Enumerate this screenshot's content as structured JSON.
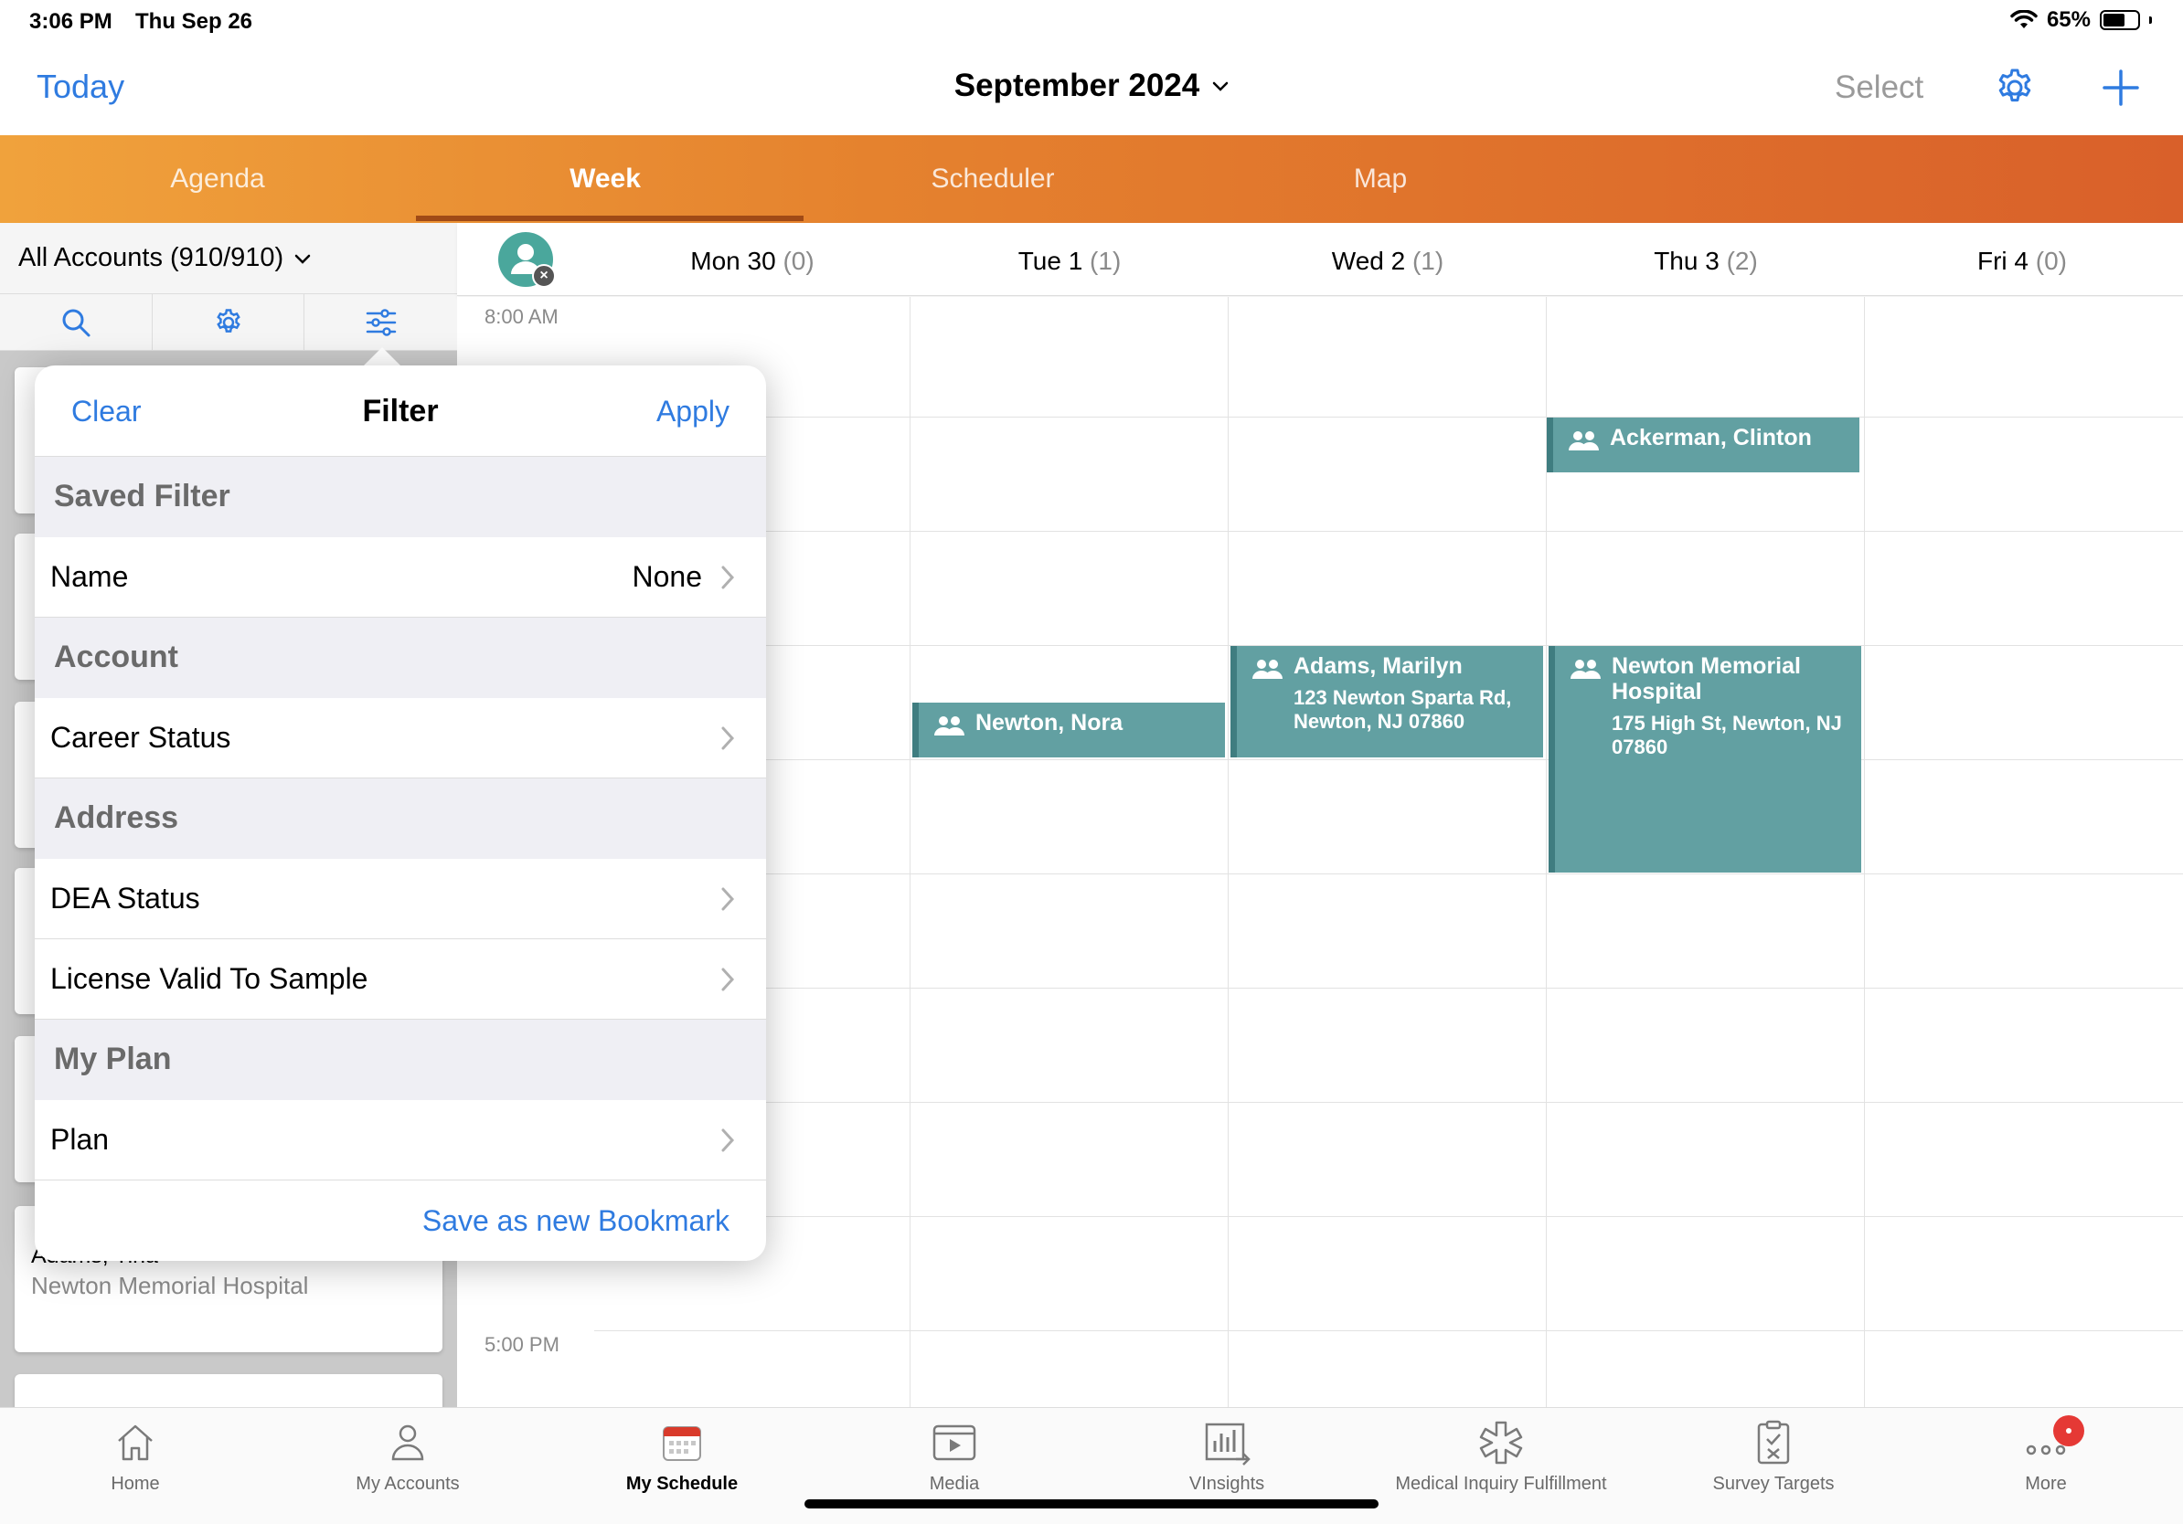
{
  "status": {
    "time": "3:06 PM",
    "date": "Thu Sep 26",
    "battery": "65%",
    "battery_level": 0.65
  },
  "nav": {
    "today": "Today",
    "title": "September 2024",
    "select": "Select"
  },
  "tabs": [
    {
      "label": "Agenda"
    },
    {
      "label": "Week"
    },
    {
      "label": "Scheduler"
    },
    {
      "label": "Map"
    }
  ],
  "active_tab": "Week",
  "accounts": {
    "title": "All Accounts (910/910)"
  },
  "left_list": [
    {
      "name": "Adams, Tina",
      "subtitle": "Newton Memorial Hospital"
    }
  ],
  "days": [
    {
      "label": "Mon 30",
      "count": "(0)"
    },
    {
      "label": "Tue 1",
      "count": "(1)"
    },
    {
      "label": "Wed 2",
      "count": "(1)"
    },
    {
      "label": "Thu 3",
      "count": "(2)"
    },
    {
      "label": "Fri 4",
      "count": "(0)"
    }
  ],
  "times": {
    "start": "8:00 AM",
    "end": "5:00 PM"
  },
  "events": [
    {
      "title": "Ackerman, Clinton",
      "address": ""
    },
    {
      "title": "Newton, Nora",
      "address": ""
    },
    {
      "title": "Adams, Marilyn",
      "address": "123 Newton Sparta Rd, Newton, NJ 07860"
    },
    {
      "title": "Newton Memorial Hospital",
      "address": "175 High St, Newton, NJ 07860"
    }
  ],
  "filter": {
    "clear": "Clear",
    "title": "Filter",
    "apply": "Apply",
    "sections": [
      {
        "header": "Saved Filter",
        "rows": [
          {
            "label": "Name",
            "value": "None"
          }
        ]
      },
      {
        "header": "Account",
        "rows": [
          {
            "label": "Career Status",
            "value": ""
          }
        ]
      },
      {
        "header": "Address",
        "rows": [
          {
            "label": "DEA Status",
            "value": ""
          },
          {
            "label": "License Valid To Sample",
            "value": ""
          }
        ]
      },
      {
        "header": "My Plan",
        "rows": [
          {
            "label": "Plan",
            "value": ""
          }
        ]
      }
    ],
    "bookmark": "Save as new Bookmark"
  },
  "bottom_tabs": [
    {
      "label": "Home",
      "icon": "home-icon"
    },
    {
      "label": "My Accounts",
      "icon": "person-icon"
    },
    {
      "label": "My Schedule",
      "icon": "calendar-icon"
    },
    {
      "label": "Media",
      "icon": "media-icon"
    },
    {
      "label": "VInsights",
      "icon": "chart-icon"
    },
    {
      "label": "Medical Inquiry Fulfillment",
      "icon": "medical-icon"
    },
    {
      "label": "Survey Targets",
      "icon": "clipboard-icon"
    },
    {
      "label": "More",
      "icon": "more-icon"
    }
  ],
  "colors": {
    "accent": "#2f7be0",
    "event": "#62a0a2",
    "tab_start": "#f0a23c",
    "tab_end": "#d9602a"
  }
}
